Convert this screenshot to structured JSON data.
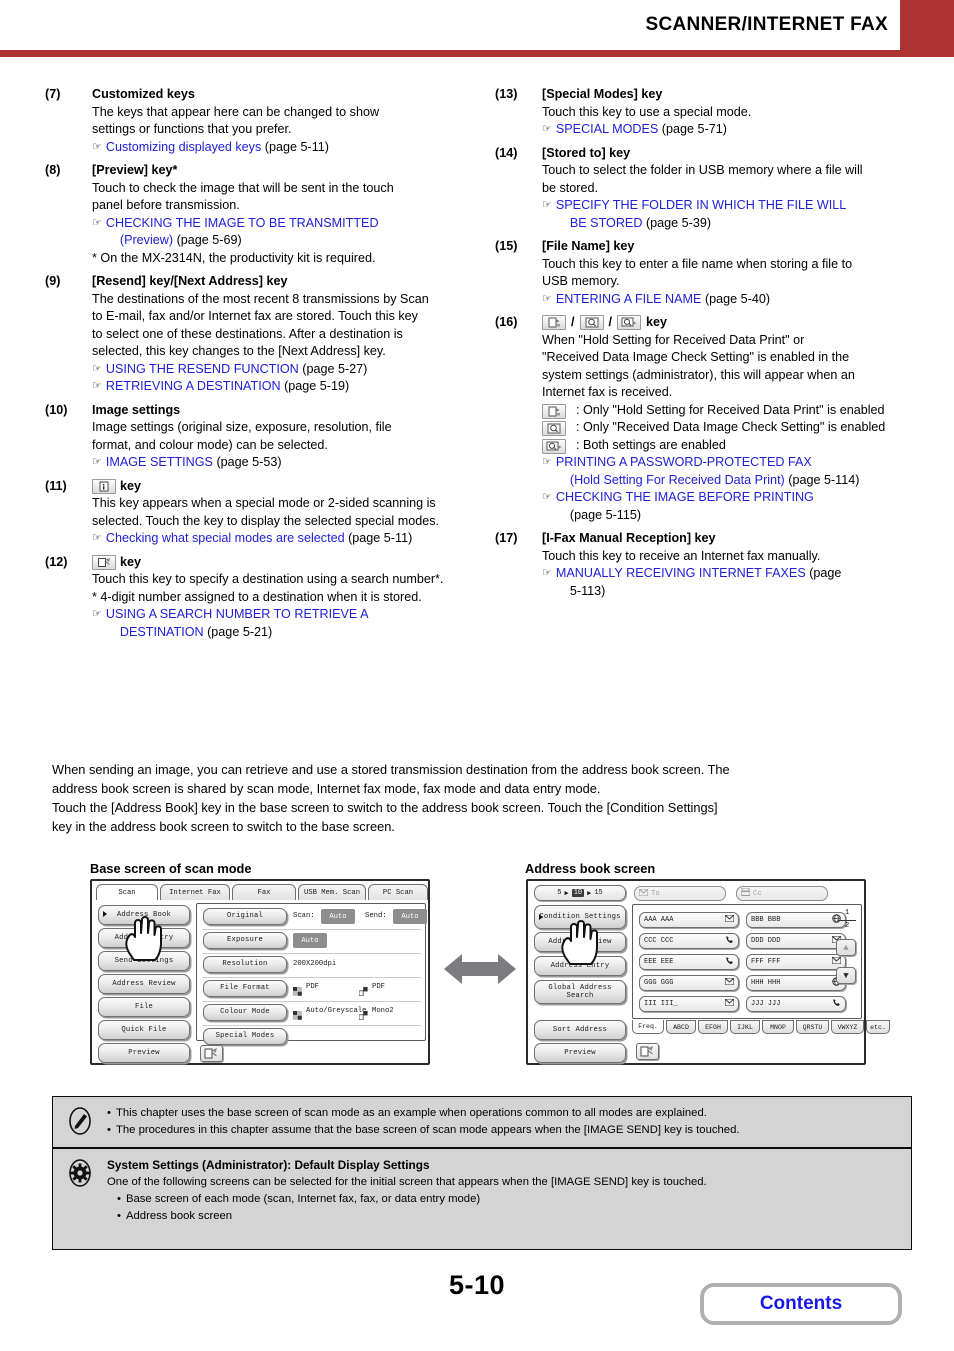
{
  "header": {
    "title": "SCANNER/INTERNET FAX",
    "accent_color": "#ae3333"
  },
  "items": [
    {
      "num": "(7)",
      "title": "Customized keys",
      "lines": [
        "The keys that appear here can be changed to show",
        "settings or functions that you prefer."
      ],
      "refs": [
        {
          "link": "Customizing displayed keys",
          "page": "(page 5-11)"
        }
      ]
    },
    {
      "num": "(8)",
      "title": "[Preview] key*",
      "lines": [
        "Touch to check the image that will be sent in the touch",
        "panel before transmission."
      ],
      "refs": [
        {
          "link": "CHECKING THE IMAGE TO BE TRANSMITTED",
          "link2": "(Preview)",
          "page": "(page 5-69)"
        }
      ],
      "footnote": "* On the MX-2314N, the productivity kit is required."
    },
    {
      "num": "(9)",
      "title": "[Resend] key/[Next Address] key",
      "lines": [
        "The destinations of the most recent 8 transmissions by Scan",
        "to E-mail, fax and/or Internet fax are stored. Touch this key",
        "to select one of these destinations. After a destination is",
        "selected, this key changes to the [Next Address] key."
      ],
      "refs": [
        {
          "link": "USING THE RESEND FUNCTION",
          "page": "(page 5-27)"
        },
        {
          "link": "RETRIEVING A DESTINATION",
          "page": "(page 5-19)"
        }
      ]
    },
    {
      "num": "(10)",
      "title": "Image settings",
      "lines": [
        "Image settings (original size, exposure, resolution, file",
        "format, and colour mode) can be selected."
      ],
      "refs": [
        {
          "link": "IMAGE SETTINGS",
          "page": "(page 5-53)"
        }
      ]
    },
    {
      "num": "(11)",
      "title_icon": "info-box-icon",
      "title": "key",
      "lines": [
        "This key appears when a special mode or 2-sided scanning is",
        "selected. Touch the key to display the selected special modes."
      ],
      "refs": [
        {
          "link": "Checking what special modes are selected",
          "page": "(page 5-11)"
        }
      ]
    },
    {
      "num": "(12)",
      "title_icon": "search-number-icon",
      "title": "key",
      "lines": [
        "Touch this key to specify a destination using a search number*.",
        "* 4-digit number assigned to a destination when it is stored."
      ],
      "refs": [
        {
          "link": "USING A SEARCH NUMBER TO RETRIEVE A",
          "link2": "DESTINATION",
          "page": "(page 5-21)"
        }
      ]
    }
  ],
  "items_right": [
    {
      "num": "(13)",
      "title": "[Special Modes] key",
      "lines": [
        "Touch this key to use a special mode."
      ],
      "refs": [
        {
          "link": "SPECIAL MODES",
          "page": "(page 5-71)"
        }
      ]
    },
    {
      "num": "(14)",
      "title": "[Stored to] key",
      "lines": [
        "Touch to select the folder in USB memory where a file will",
        "be stored."
      ],
      "refs": [
        {
          "link": "SPECIFY THE FOLDER IN WHICH THE FILE WILL",
          "link2": "BE STORED",
          "page": "(page 5-39)"
        }
      ]
    },
    {
      "num": "(15)",
      "title": "[File Name] key",
      "lines": [
        "Touch this key to enter a file name when storing a file to",
        "USB memory."
      ],
      "refs": [
        {
          "link": "ENTERING A FILE NAME",
          "page": "(page 5-40)"
        }
      ]
    },
    {
      "num": "(16)",
      "title": "key",
      "title_icons": [
        "hold-print-icon",
        "image-check-icon",
        "both-settings-icon"
      ],
      "lines": [
        "When \"Hold Setting for Received Data Print\" or",
        "\"Received Data Image Check Setting\" is enabled in the",
        "system settings (administrator), this will appear when an",
        "Internet fax is received."
      ],
      "icon_lines": [
        {
          "icon": "hold-print-icon",
          "text": ": Only \"Hold Setting for Received Data Print\" is enabled"
        },
        {
          "icon": "image-check-icon",
          "text": ": Only \"Received Data Image Check Setting\" is enabled"
        },
        {
          "icon": "both-settings-icon",
          "text": ": Both settings are enabled"
        }
      ],
      "refs": [
        {
          "link": "PRINTING A PASSWORD-PROTECTED FAX",
          "link2": "(Hold Setting For Received Data Print)",
          "page": "(page 5-114)"
        },
        {
          "link": "CHECKING THE IMAGE BEFORE PRINTING",
          "page": "(page 5-115)",
          "page_on_own_line": true
        }
      ]
    },
    {
      "num": "(17)",
      "title": "[I-Fax Manual Reception] key",
      "lines": [
        "Touch this key to receive an Internet fax manually."
      ],
      "refs": [
        {
          "link": "MANUALLY RECEIVING INTERNET FAXES",
          "page": "(page",
          "page2": "5-113)"
        }
      ]
    }
  ],
  "mid_paragraph": {
    "line1": "When sending an image, you can retrieve and use a stored transmission destination from the address book screen. The",
    "line2": "address book screen is shared by scan mode, Internet fax mode, fax mode and data entry mode.",
    "line3": "Touch the [Address Book] key in the base screen to switch to the address book screen. Touch the [Condition Settings]",
    "line4": "key in the address book screen to switch to the base screen."
  },
  "diagrams": {
    "left_caption": "Base screen of scan mode",
    "right_caption": "Address book screen",
    "base_screen": {
      "tabs": [
        "Scan",
        "Internet Fax",
        "Fax",
        "USB Mem. Scan",
        "PC Scan"
      ],
      "active_tab": "Scan",
      "side_buttons": [
        "Address Book",
        "Address Entry",
        "Send Settings",
        "Address Review",
        "File",
        "Quick File",
        "Preview"
      ],
      "rows": [
        {
          "button": "Original",
          "label": "Scan:",
          "value": "Auto",
          "label2": "Send:",
          "value2": "Auto"
        },
        {
          "button": "Exposure",
          "value": "Auto"
        },
        {
          "button": "Resolution",
          "text": "200X200dpi"
        },
        {
          "button": "File Format",
          "opt1": "PDF",
          "opt2": "PDF"
        },
        {
          "button": "Colour Mode",
          "opt1": "Auto/Greyscale",
          "opt2": "Mono2"
        },
        {
          "button": "Special Modes"
        }
      ],
      "footer_icon": "search-number-icon"
    },
    "address_book_screen": {
      "counter": {
        "left": "5",
        "selected": "10",
        "right": "15"
      },
      "to_label": "To",
      "cc_label": "Cc",
      "side_buttons": [
        "Condition Settings",
        "Address Review",
        "Address Entry",
        "Global Address Search",
        "Sort Address",
        "Preview"
      ],
      "addresses": [
        {
          "name": "AAA AAA",
          "icon": "envelope-icon"
        },
        {
          "name": "BBB BBB",
          "icon": "globe-icon"
        },
        {
          "name": "CCC CCC",
          "icon": "phone-icon"
        },
        {
          "name": "DDD DDD",
          "icon": "envelope-icon"
        },
        {
          "name": "EEE EEE",
          "icon": "phone-icon"
        },
        {
          "name": "FFF FFF",
          "icon": "envelope-icon"
        },
        {
          "name": "GGG GGG",
          "icon": "envelope-icon"
        },
        {
          "name": "HHH HHH",
          "icon": "globe-icon"
        },
        {
          "name": "III III_",
          "icon": "envelope-icon"
        },
        {
          "name": "JJJ JJJ",
          "icon": "phone-icon"
        }
      ],
      "page_current": "1",
      "page_total": "2",
      "alpha_tabs": [
        "Freq.",
        "ABCD",
        "EFGH",
        "IJKL",
        "MNOP",
        "QRSTU",
        "VWXYZ",
        "etc."
      ],
      "active_alpha_tab": "Freq.",
      "footer_icon": "search-number-icon"
    }
  },
  "notes": {
    "pencil_items": [
      "This chapter uses the base screen of scan mode as an example when operations common to all modes are explained.",
      "The procedures in this chapter assume that the base screen of scan mode appears when the [IMAGE SEND] key is touched."
    ],
    "gear_heading": "System Settings (Administrator): Default Display Settings",
    "gear_paragraph": "One of the following screens can be selected for the initial screen that appears when the [IMAGE SEND] key is touched.",
    "gear_items": [
      "Base screen of each mode (scan, Internet fax, fax, or data entry mode)",
      "Address book screen"
    ]
  },
  "footer": {
    "page_number": "5-10",
    "contents_label": "Contents"
  }
}
